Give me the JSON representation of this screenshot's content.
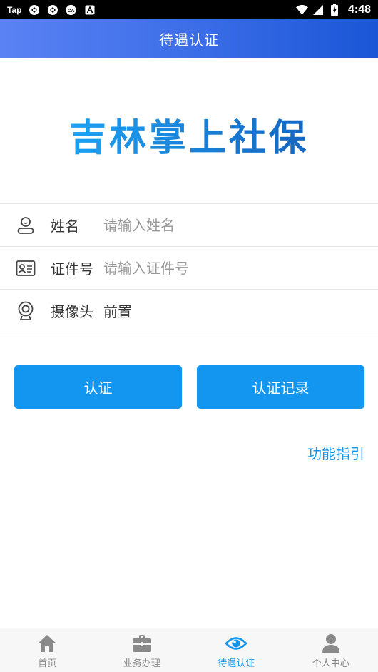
{
  "status_bar": {
    "app_label": "Tap",
    "time": "4:48"
  },
  "header": {
    "title": "待遇认证"
  },
  "logo": {
    "text": "吉林掌上社保"
  },
  "form": {
    "name": {
      "label": "姓名",
      "placeholder": "请输入姓名",
      "value": ""
    },
    "id_number": {
      "label": "证件号",
      "placeholder": "请输入证件号",
      "value": ""
    },
    "camera": {
      "label": "摄像头",
      "value": "前置"
    }
  },
  "buttons": {
    "auth": "认证",
    "records": "认证记录"
  },
  "guide_link": "功能指引",
  "tabs": [
    {
      "label": "首页",
      "icon": "home-icon"
    },
    {
      "label": "业务办理",
      "icon": "briefcase-icon"
    },
    {
      "label": "待遇认证",
      "icon": "eye-icon",
      "active": true
    },
    {
      "label": "个人中心",
      "icon": "person-icon"
    }
  ],
  "colors": {
    "accent": "#1296ef",
    "header_start": "#5a82f4",
    "header_end": "#1a56d6",
    "inactive_icon": "#8a8a8a"
  }
}
